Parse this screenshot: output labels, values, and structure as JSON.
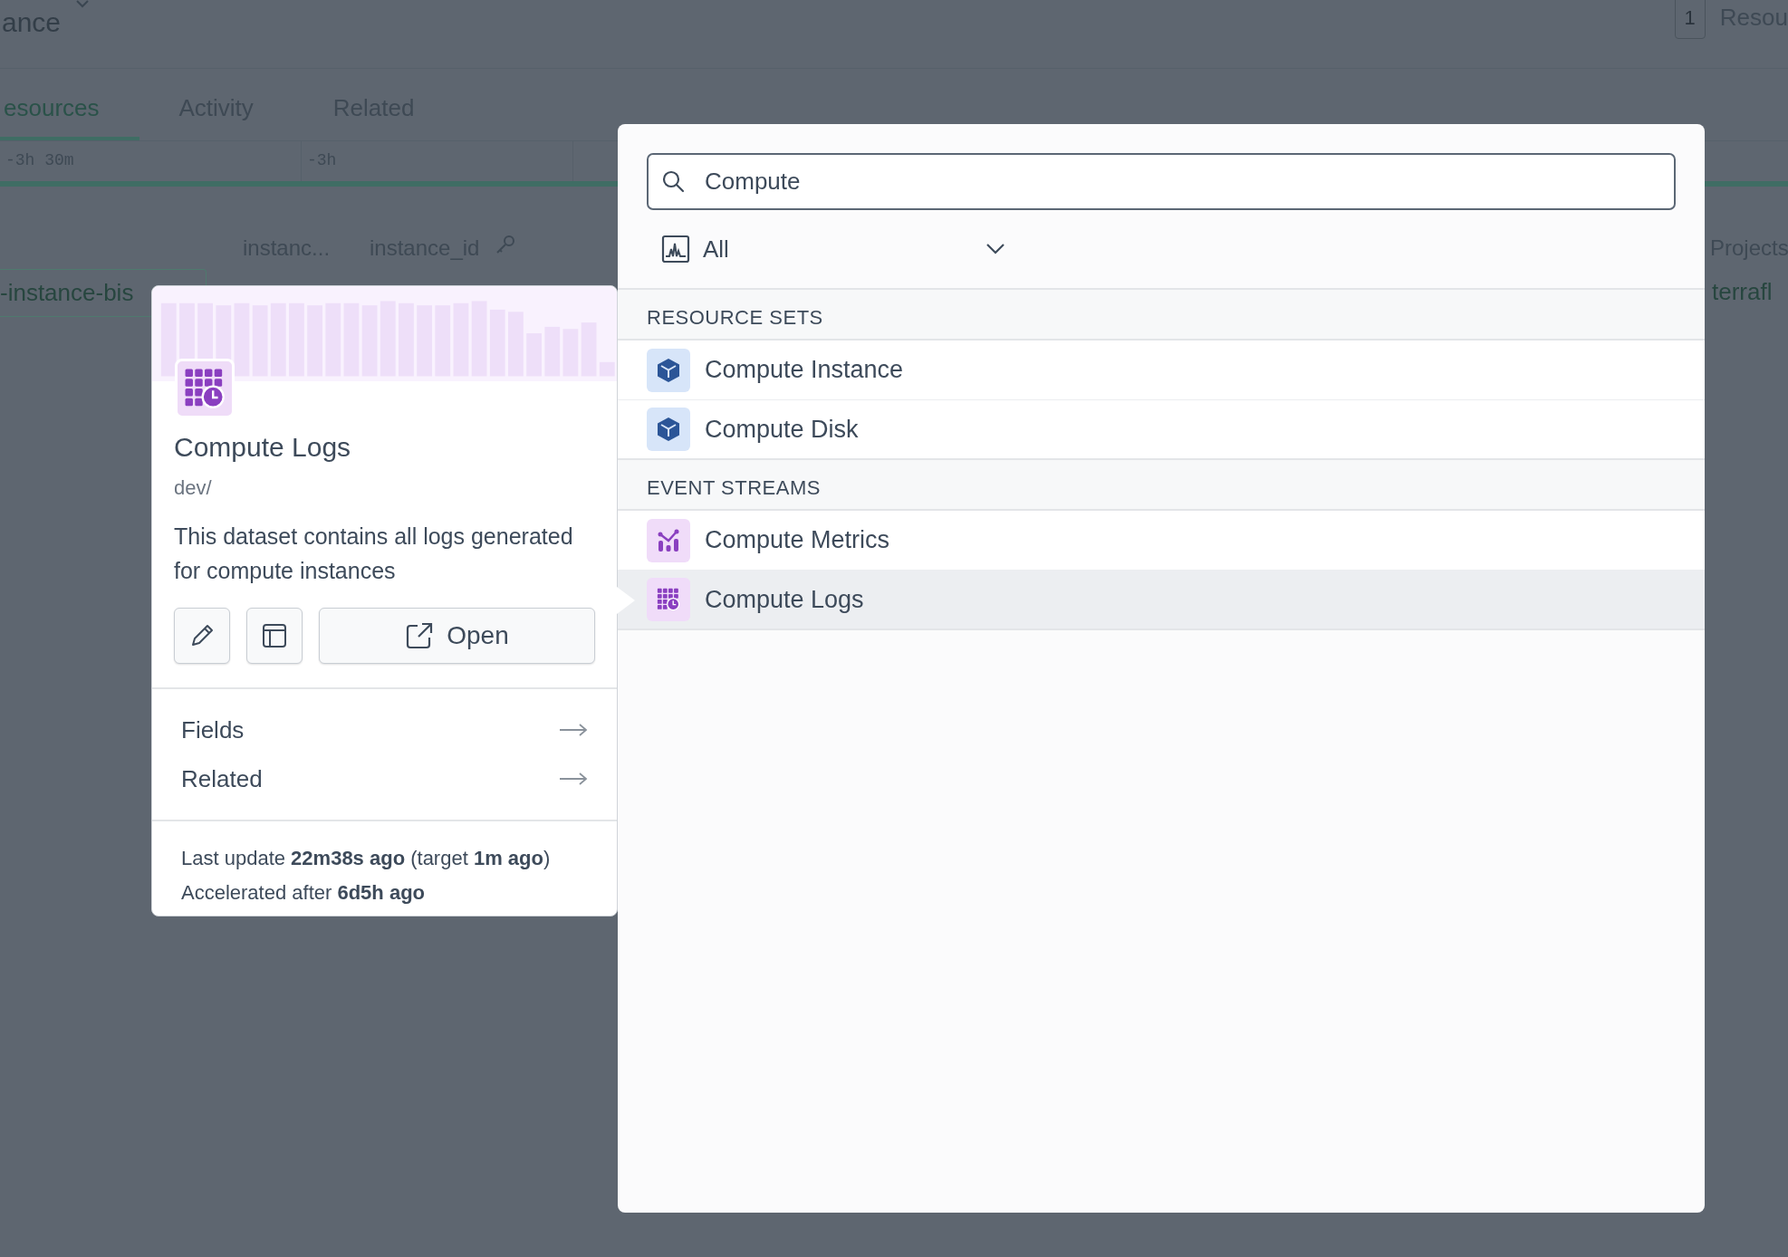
{
  "background": {
    "title": "ance",
    "badge": "1",
    "top_right_label": "Resou",
    "tabs": [
      {
        "label": "esources",
        "selected": true
      },
      {
        "label": "Activity",
        "selected": false
      },
      {
        "label": "Related",
        "selected": false
      }
    ],
    "timeline_labels": [
      "-3h 30m",
      "-3h"
    ],
    "table": {
      "columns": [
        "instanc...",
        "instance_id",
        "Projects"
      ],
      "cells": [
        "-instance-bis",
        "terrafl"
      ]
    }
  },
  "search": {
    "value": "Compute",
    "filter": "All"
  },
  "sections": [
    {
      "title": "RESOURCE SETS",
      "items": [
        {
          "label": "Compute Instance",
          "kind": "resource_set",
          "selected": false
        },
        {
          "label": "Compute Disk",
          "kind": "resource_set",
          "selected": false
        }
      ]
    },
    {
      "title": "EVENT STREAMS",
      "items": [
        {
          "label": "Compute Metrics",
          "kind": "metrics",
          "selected": false
        },
        {
          "label": "Compute Logs",
          "kind": "logs",
          "selected": true
        }
      ]
    }
  ],
  "detail": {
    "kind": "logs",
    "title": "Compute Logs",
    "path": "dev/",
    "description": "This dataset contains all logs generated for compute instances",
    "open_button": "Open",
    "links": [
      "Fields",
      "Related"
    ],
    "status_lines": [
      "Last update **22m38s ago** (target **1m ago**)",
      "Accelerated after **6d5h ago**"
    ]
  }
}
